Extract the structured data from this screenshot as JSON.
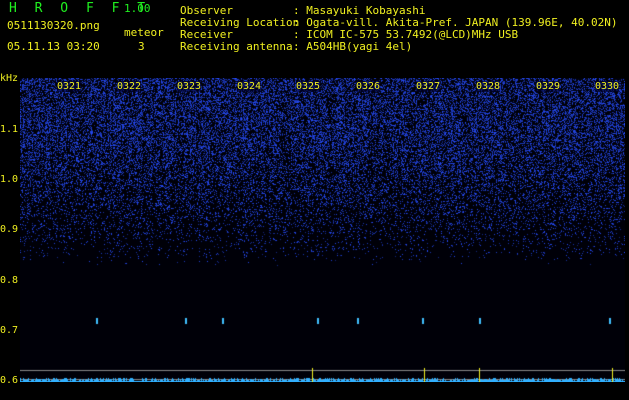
{
  "app": {
    "title": "H R O F F T",
    "version": "1.00"
  },
  "file": {
    "name": "0511130320.png",
    "datetime": "05.11.13 03:20"
  },
  "meteor": {
    "label": "meteor",
    "count": "3"
  },
  "meta": [
    {
      "key": "Observer",
      "value": ": Masayuki Kobayashi"
    },
    {
      "key": "Receiving Location",
      "value": ": Ogata-vill. Akita-Pref. JAPAN (139.96E, 40.02N)"
    },
    {
      "key": "Receiver",
      "value": ": ICOM IC-575 53.7492(@LCD)MHz USB"
    },
    {
      "key": "Receiving antenna",
      "value": ": A504HB(yagi 4el)"
    }
  ],
  "axis": {
    "unit": "kHz",
    "y_ticks": [
      "1.1",
      "1.0",
      "0.9",
      "0.8",
      "0.7",
      "0.6"
    ],
    "x_ticks": [
      "0321",
      "0322",
      "0323",
      "0324",
      "0325",
      "0326",
      "0327",
      "0328",
      "0329",
      "0330"
    ]
  },
  "colors": {
    "label": "#f0f020",
    "title": "#20f020",
    "noise": "#2040ff",
    "trace": "#40c0ff"
  }
}
